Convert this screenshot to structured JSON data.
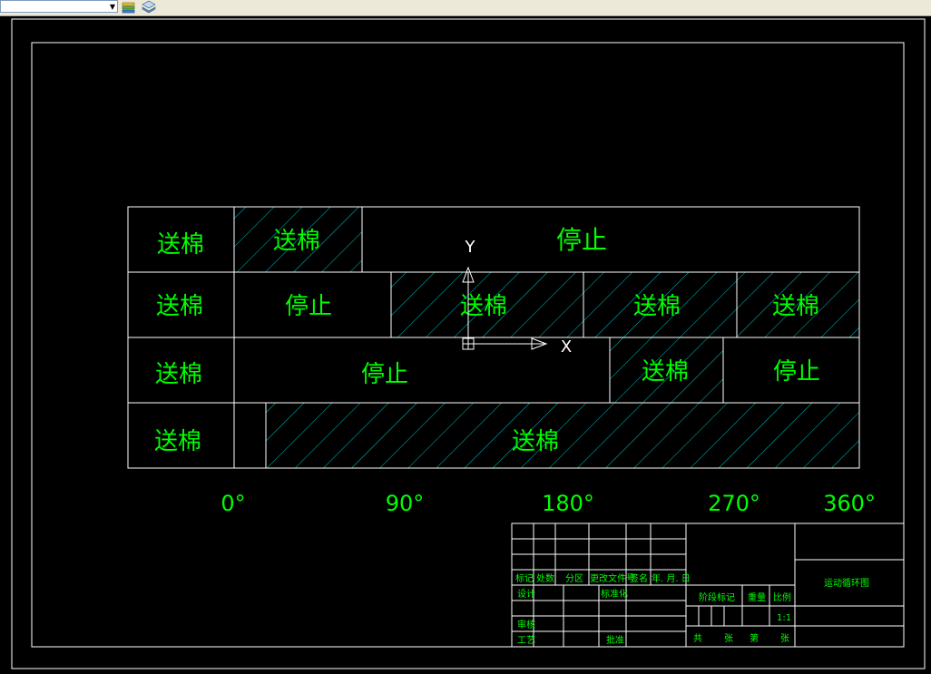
{
  "toolbar": {
    "layer_combo_value": "",
    "icons": [
      "layer-states-icon",
      "layer-stack-icon"
    ]
  },
  "diagram": {
    "rows": [
      {
        "label": "送棉",
        "segments": [
          {
            "text": "送棉",
            "hatched": true
          },
          {
            "text": "停止",
            "hatched": false
          }
        ]
      },
      {
        "label": "送棉",
        "segments": [
          {
            "text": "停止",
            "hatched": false
          },
          {
            "text": "送棉",
            "hatched": true
          },
          {
            "text": "送棉",
            "hatched": true
          },
          {
            "text": "送棉",
            "hatched": true
          }
        ]
      },
      {
        "label": "送棉",
        "segments": [
          {
            "text": "停止",
            "hatched": false
          },
          {
            "text": "送棉",
            "hatched": true
          },
          {
            "text": "停止",
            "hatched": false
          }
        ]
      },
      {
        "label": "送棉",
        "segments": [
          {
            "text": "",
            "hatched": false
          },
          {
            "text": "送棉",
            "hatched": true
          }
        ]
      }
    ],
    "angles": [
      "0°",
      "90°",
      "180°",
      "270°",
      "360°"
    ],
    "ucs": {
      "x_label": "X",
      "y_label": "Y"
    }
  },
  "title_block": {
    "title": "运动循环图",
    "marker": "标记",
    "count": "处数",
    "zone": "分区",
    "change_doc": "更改文件号",
    "sign": "签名",
    "date": "年. 月. 日",
    "design": "设计",
    "standard": "标准化",
    "review": "审核",
    "process": "工艺",
    "approve": "批准",
    "stage_mark": "阶段标记",
    "weight": "重量",
    "scale": "比例",
    "scale_value": "1:1",
    "total": "共",
    "sheets": "张",
    "page": "第",
    "sheet": "张"
  },
  "colors": {
    "background": "#000000",
    "text": "#00ff00",
    "lines": "#ffffff",
    "hatch": "#00d8d8"
  }
}
